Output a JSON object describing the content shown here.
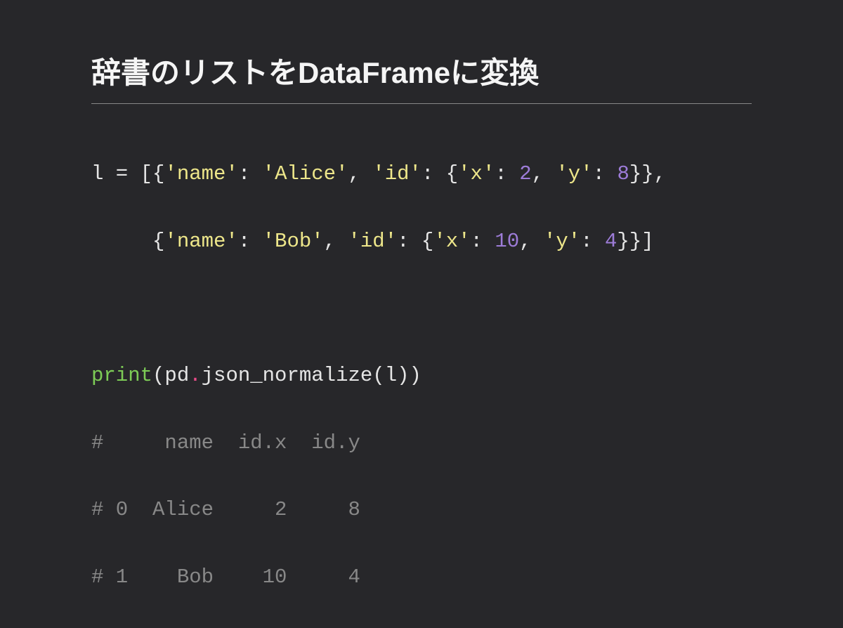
{
  "title": "辞書のリストをDataFrameに変換",
  "code": {
    "l1": {
      "var": "l",
      "eq": " = ",
      "b1": "[{",
      "s1": "'name'",
      "c1": ": ",
      "s2": "'Alice'",
      "cm1": ", ",
      "s3": "'id'",
      "c2": ": ",
      "b2": "{",
      "s4": "'x'",
      "c3": ": ",
      "n1": "2",
      "cm2": ", ",
      "s5": "'y'",
      "c4": ": ",
      "n2": "8",
      "b3": "}},"
    },
    "l2": {
      "indent": "     ",
      "b1": "{",
      "s1": "'name'",
      "c1": ": ",
      "s2": "'Bob'",
      "cm1": ", ",
      "s3": "'id'",
      "c2": ": ",
      "b2": "{",
      "s4": "'x'",
      "c3": ": ",
      "n1": "10",
      "cm2": ", ",
      "s5": "'y'",
      "c4": ": ",
      "n2": "4",
      "b3": "}}]"
    },
    "l3": {
      "fn": "print",
      "p1": "(",
      "mod": "pd",
      "dot": ".",
      "method": "json_normalize",
      "p2": "(",
      "arg": "l",
      "p3": "))"
    },
    "comment1": "#     name  id.x  id.y",
    "comment2": "# 0  Alice     2     8",
    "comment3": "# 1    Bob    10     4"
  }
}
